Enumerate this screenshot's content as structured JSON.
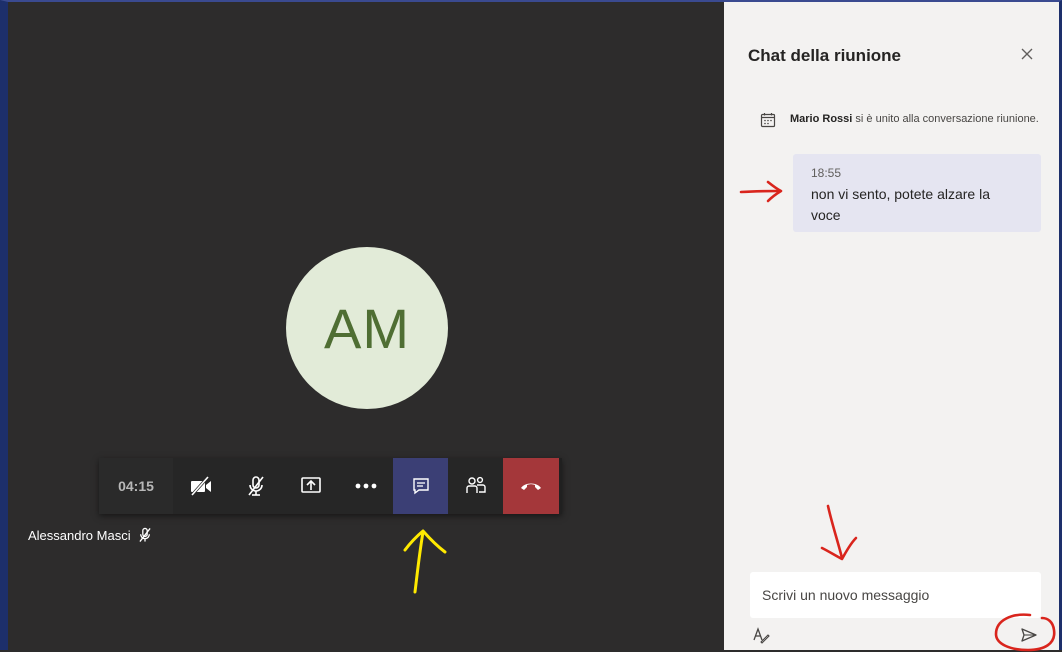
{
  "meeting": {
    "avatar_initials": "AM",
    "timer": "04:15",
    "participant_name": "Alessandro Masci",
    "toolbar": [
      {
        "id": "camera",
        "icon": "camera-off-icon"
      },
      {
        "id": "mic",
        "icon": "mic-off-icon"
      },
      {
        "id": "share",
        "icon": "share-screen-icon"
      },
      {
        "id": "more",
        "icon": "more-icon"
      },
      {
        "id": "chat",
        "icon": "chat-icon",
        "active": true
      },
      {
        "id": "participants",
        "icon": "people-icon"
      },
      {
        "id": "hangup",
        "icon": "hangup-icon"
      }
    ]
  },
  "chat": {
    "title": "Chat della riunione",
    "system_message": {
      "name": "Mario Rossi",
      "text": " si è unito alla conversazione riunione."
    },
    "messages": [
      {
        "time": "18:55",
        "text": "non vi sento, potete alzare la voce"
      }
    ],
    "compose_placeholder": "Scrivi un nuovo messaggio"
  },
  "colors": {
    "stage_bg": "#2d2c2c",
    "panel_bg": "#f3f2f1",
    "accent": "#3b3f75",
    "hangup": "#a4373a",
    "avatar_bg": "#e2ebd8",
    "avatar_fg": "#4f6e33",
    "annotation_red": "#d9251d",
    "annotation_yellow": "#ffea00"
  }
}
